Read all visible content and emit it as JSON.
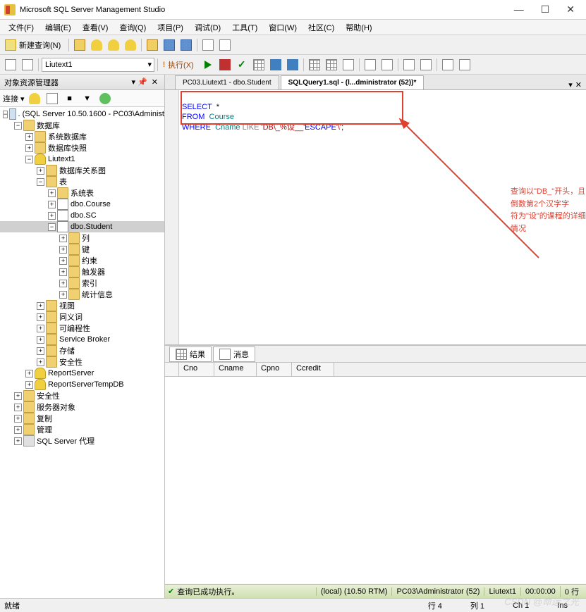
{
  "app": {
    "title": "Microsoft SQL Server Management Studio"
  },
  "menus": [
    "文件(F)",
    "编辑(E)",
    "查看(V)",
    "查询(Q)",
    "项目(P)",
    "调试(D)",
    "工具(T)",
    "窗口(W)",
    "社区(C)",
    "帮助(H)"
  ],
  "toolbar1": {
    "newQuery": "新建查询(N)"
  },
  "toolbar2": {
    "currentDb": "Liutext1",
    "execute": "执行(X)"
  },
  "objectExplorer": {
    "title": "对象资源管理器",
    "connectLabel": "连接 ▾",
    "root": ". (SQL Server 10.50.1600 - PC03\\Administ",
    "dbFolder": "数据库",
    "sysDb": "系统数据库",
    "dbSnap": "数据库快照",
    "userDb": "Liutext1",
    "dbDiagram": "数据库关系图",
    "tables": "表",
    "sysTables": "系统表",
    "t1": "dbo.Course",
    "t2": "dbo.SC",
    "t3": "dbo.Student",
    "cols": "列",
    "keys": "键",
    "constraints": "约束",
    "triggers": "触发器",
    "indexes": "索引",
    "stats": "统计信息",
    "views": "视图",
    "synonyms": "同义词",
    "prog": "可编程性",
    "sb": "Service Broker",
    "storage": "存储",
    "security": "安全性",
    "rs": "ReportServer",
    "rst": "ReportServerTempDB",
    "topSecurity": "安全性",
    "serverObj": "服务器对象",
    "replication": "复制",
    "mgmt": "管理",
    "agent": "SQL Server 代理"
  },
  "tabs": {
    "tab1": "PC03.Liutext1 - dbo.Student",
    "tab2": "SQLQuery1.sql - (l...dministrator (52))*"
  },
  "sql": {
    "line1_kw": "SELECT",
    "line1_rest": "  *",
    "line2_kw": "FROM",
    "line2_tbl": "  Course",
    "line3_kw": "WHERE",
    "line3_col": "  Cname ",
    "line3_like": "LIKE ",
    "line3_str1": "'DB\\_%设__'",
    "line3_esc": "ESCAPE",
    "line3_str2": "'\\'",
    "line3_semi": ";"
  },
  "annotation": {
    "line1": "查询以\"DB_\"开头，且倒数第2个汉字字",
    "line2": "符为\"设\"的课程的详细情况"
  },
  "results": {
    "tabResults": "结果",
    "tabMessages": "消息",
    "cols": [
      "Cno",
      "Cname",
      "Cpno",
      "Ccredit"
    ]
  },
  "statusGreen": {
    "msg": "查询已成功执行。",
    "server": "(local) (10.50 RTM)",
    "user": "PC03\\Administrator (52)",
    "db": "Liutext1",
    "time": "00:00:00",
    "rows": "0 行"
  },
  "statusbar": {
    "ready": "就绪",
    "line": "行 4",
    "col": "列 1",
    "ch": "Ch 1",
    "ins": "Ins"
  },
  "watermark": "CSDN @命运之光"
}
